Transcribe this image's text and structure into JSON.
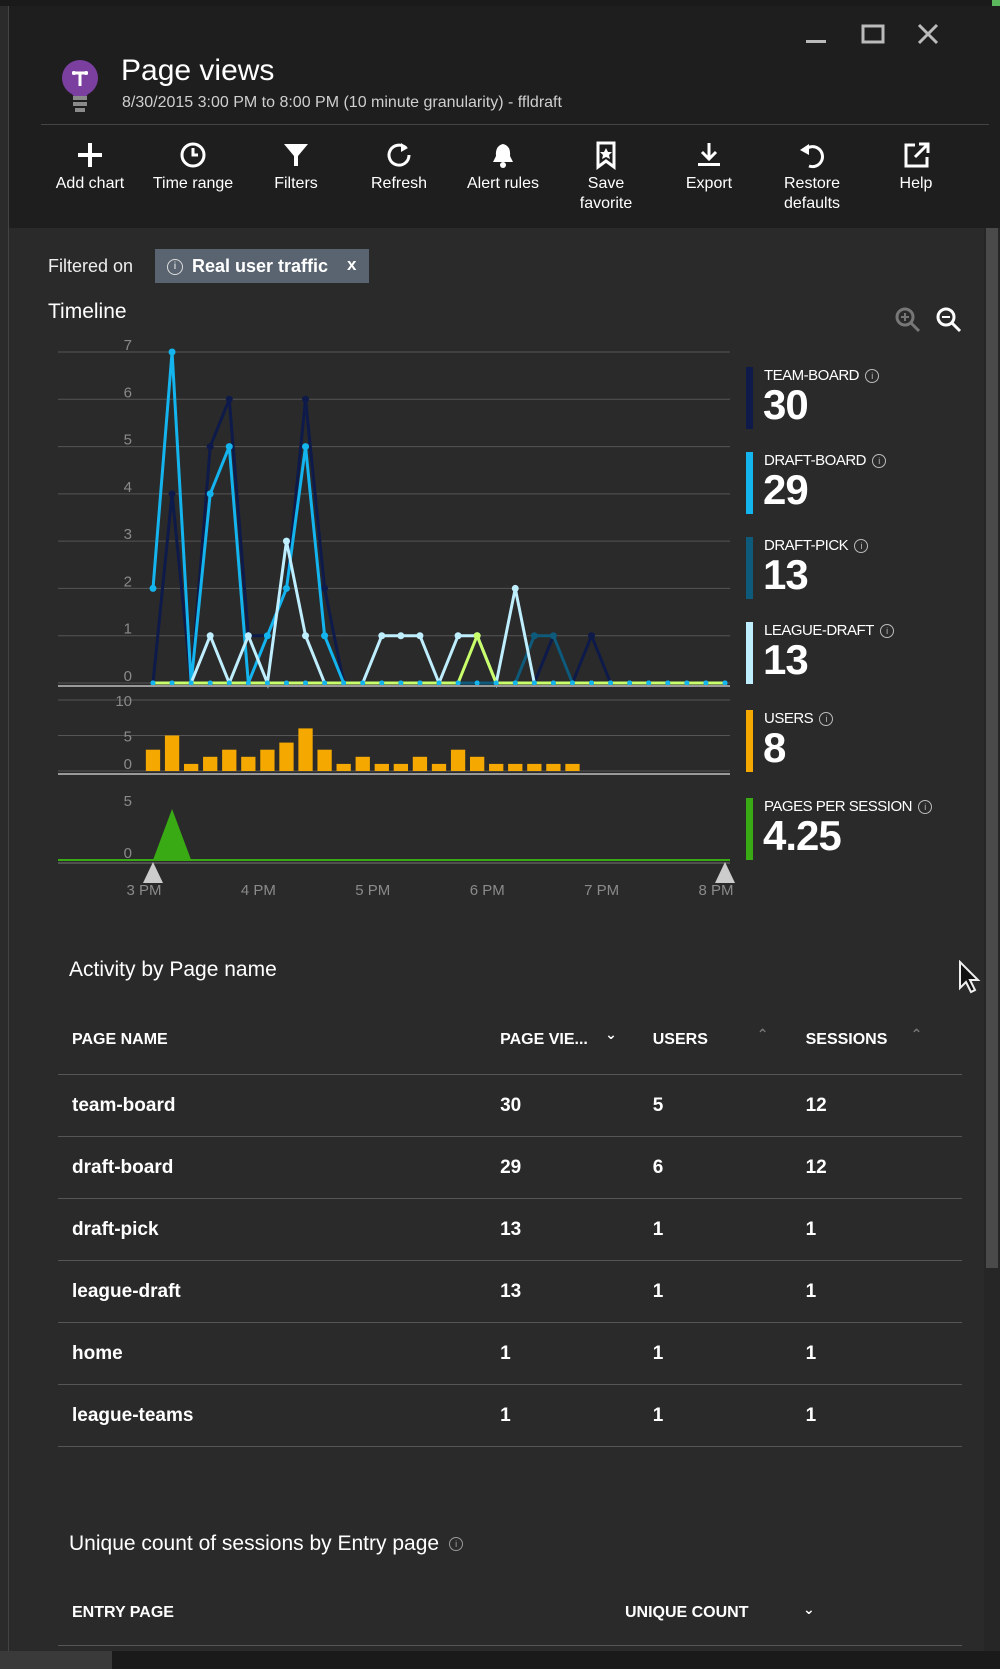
{
  "header": {
    "title": "Page views",
    "subtitle": "8/30/2015 3:00 PM to 8:00 PM (10 minute granularity) - ffldraft",
    "window_controls": [
      "minimize-icon",
      "maximize-icon",
      "close-icon"
    ]
  },
  "toolbar": {
    "add_chart": "Add chart",
    "time_range": "Time range",
    "filters": "Filters",
    "refresh": "Refresh",
    "alert_rules": "Alert rules",
    "save_favorite_1": "Save",
    "save_favorite_2": "favorite",
    "export": "Export",
    "restore_defaults_1": "Restore",
    "restore_defaults_2": "defaults",
    "help": "Help"
  },
  "filter": {
    "label": "Filtered on",
    "chip": "Real user traffic",
    "chip_close": "x"
  },
  "timeline": {
    "title": "Timeline"
  },
  "legend": [
    {
      "name": "TEAM-BOARD",
      "value": "30",
      "color": "#0d1a4a"
    },
    {
      "name": "DRAFT-BOARD",
      "value": "29",
      "color": "#14b4ee"
    },
    {
      "name": "DRAFT-PICK",
      "value": "13",
      "color": "#0e5a7a"
    },
    {
      "name": "LEAGUE-DRAFT",
      "value": "13",
      "color": "#bfefff"
    },
    {
      "name": "USERS",
      "value": "8",
      "color": "#f5a800"
    },
    {
      "name": "PAGES PER SESSION",
      "value": "4.25",
      "color": "#3aaa14"
    }
  ],
  "chart_data": [
    {
      "type": "line",
      "title": "Timeline",
      "ylim": [
        0,
        7
      ],
      "yticks": [
        "7",
        "6",
        "5",
        "4",
        "3",
        "2",
        "1",
        "0"
      ],
      "xticks": [
        "3 PM",
        "4 PM",
        "5 PM",
        "6 PM",
        "7 PM",
        "8 PM"
      ],
      "x": [
        "3:00",
        "3:10",
        "3:20",
        "3:30",
        "3:40",
        "3:50",
        "4:00",
        "4:10",
        "4:20",
        "4:30",
        "4:40",
        "4:50",
        "5:00",
        "5:10",
        "5:20",
        "5:30",
        "5:40",
        "5:50",
        "6:00",
        "6:10",
        "6:20",
        "6:30",
        "6:40",
        "6:50",
        "7:00",
        "7:10",
        "7:20",
        "7:30",
        "7:40",
        "7:50",
        "8:00"
      ],
      "series": [
        {
          "name": "TEAM-BOARD",
          "color": "#0d1a4a",
          "values": [
            0,
            4,
            0,
            5,
            6,
            1,
            1,
            2,
            6,
            2,
            0,
            0,
            0,
            0,
            0,
            0,
            0,
            0,
            0,
            0,
            0,
            1,
            0,
            1,
            0,
            0,
            0,
            0,
            0,
            0,
            0
          ]
        },
        {
          "name": "DRAFT-BOARD",
          "color": "#14b4ee",
          "values": [
            2,
            7,
            0,
            4,
            5,
            0,
            1,
            2,
            5,
            1,
            0,
            0,
            0,
            0,
            0,
            0,
            0,
            0,
            0,
            0,
            0,
            0,
            0,
            0,
            0,
            0,
            0,
            0,
            0,
            0,
            0
          ]
        },
        {
          "name": "DRAFT-PICK",
          "color": "#0e5a7a",
          "values": [
            0,
            0,
            0,
            0,
            0,
            0,
            0,
            0,
            0,
            0,
            0,
            0,
            0,
            0,
            0,
            0,
            0,
            0,
            0,
            0,
            1,
            1,
            0,
            0,
            0,
            0,
            0,
            0,
            0,
            0,
            0
          ]
        },
        {
          "name": "LEAGUE-DRAFT",
          "color": "#bfefff",
          "values": [
            0,
            0,
            0,
            1,
            0,
            1,
            0,
            3,
            1,
            0,
            0,
            0,
            1,
            1,
            1,
            0,
            1,
            1,
            0,
            2,
            0,
            0,
            0,
            0,
            0,
            0,
            0,
            0,
            0,
            0,
            0
          ]
        },
        {
          "name": "",
          "color": "#c8ff6a",
          "values": [
            0,
            0,
            0,
            0,
            0,
            0,
            0,
            0,
            0,
            0,
            0,
            0,
            0,
            0,
            0,
            0,
            0,
            1,
            0,
            0,
            0,
            0,
            0,
            0,
            0,
            0,
            0,
            0,
            0,
            0,
            0
          ]
        }
      ]
    },
    {
      "type": "bar",
      "title": "USERS",
      "ylim": [
        0,
        10
      ],
      "yticks": [
        "10",
        "5",
        "0"
      ],
      "x": [
        "3:00",
        "3:10",
        "3:20",
        "3:30",
        "3:40",
        "3:50",
        "4:00",
        "4:10",
        "4:20",
        "4:30",
        "4:40",
        "4:50",
        "5:00",
        "5:10",
        "5:20",
        "5:30",
        "5:40",
        "5:50",
        "6:00",
        "6:10",
        "6:20",
        "6:30",
        "6:40",
        "6:50",
        "7:00",
        "7:10",
        "7:20",
        "7:30",
        "7:40",
        "7:50",
        "8:00"
      ],
      "series": [
        {
          "name": "USERS",
          "color": "#f5a800",
          "values": [
            3,
            5,
            1,
            2,
            3,
            2,
            3,
            4,
            6,
            3,
            1,
            2,
            1,
            1,
            2,
            1,
            3,
            2,
            1,
            1,
            1,
            1,
            1,
            0,
            0,
            0,
            0,
            0,
            0,
            0,
            0
          ]
        }
      ]
    },
    {
      "type": "area",
      "title": "PAGES PER SESSION",
      "ylim": [
        0,
        5
      ],
      "yticks": [
        "5",
        "0"
      ],
      "x": [
        "3:00",
        "3:10",
        "3:20",
        "3:30",
        "3:40",
        "3:50",
        "4:00",
        "4:10",
        "4:20",
        "4:30",
        "4:40",
        "4:50",
        "5:00",
        "5:10",
        "5:20",
        "5:30",
        "5:40",
        "5:50",
        "6:00",
        "6:10",
        "6:20",
        "6:30",
        "6:40",
        "6:50",
        "7:00",
        "7:10",
        "7:20",
        "7:30",
        "7:40",
        "7:50",
        "8:00"
      ],
      "series": [
        {
          "name": "PAGES PER SESSION",
          "color": "#3aaa14",
          "values": [
            0,
            4.25,
            0,
            0,
            0,
            0,
            0,
            0,
            0,
            0,
            0,
            0,
            0,
            0,
            0,
            0,
            0,
            0,
            0,
            0,
            0,
            0,
            0,
            0,
            0,
            0,
            0,
            0,
            0,
            0,
            0
          ]
        }
      ]
    }
  ],
  "activity": {
    "title": "Activity by Page name",
    "columns": [
      "PAGE NAME",
      "PAGE VIE...",
      "USERS",
      "SESSIONS"
    ],
    "rows": [
      [
        "team-board",
        "30",
        "5",
        "12"
      ],
      [
        "draft-board",
        "29",
        "6",
        "12"
      ],
      [
        "draft-pick",
        "13",
        "1",
        "1"
      ],
      [
        "league-draft",
        "13",
        "1",
        "1"
      ],
      [
        "home",
        "1",
        "1",
        "1"
      ],
      [
        "league-teams",
        "1",
        "1",
        "1"
      ]
    ]
  },
  "entry": {
    "title": "Unique count of sessions by Entry page",
    "columns": [
      "ENTRY PAGE",
      "UNIQUE COUNT"
    ]
  }
}
